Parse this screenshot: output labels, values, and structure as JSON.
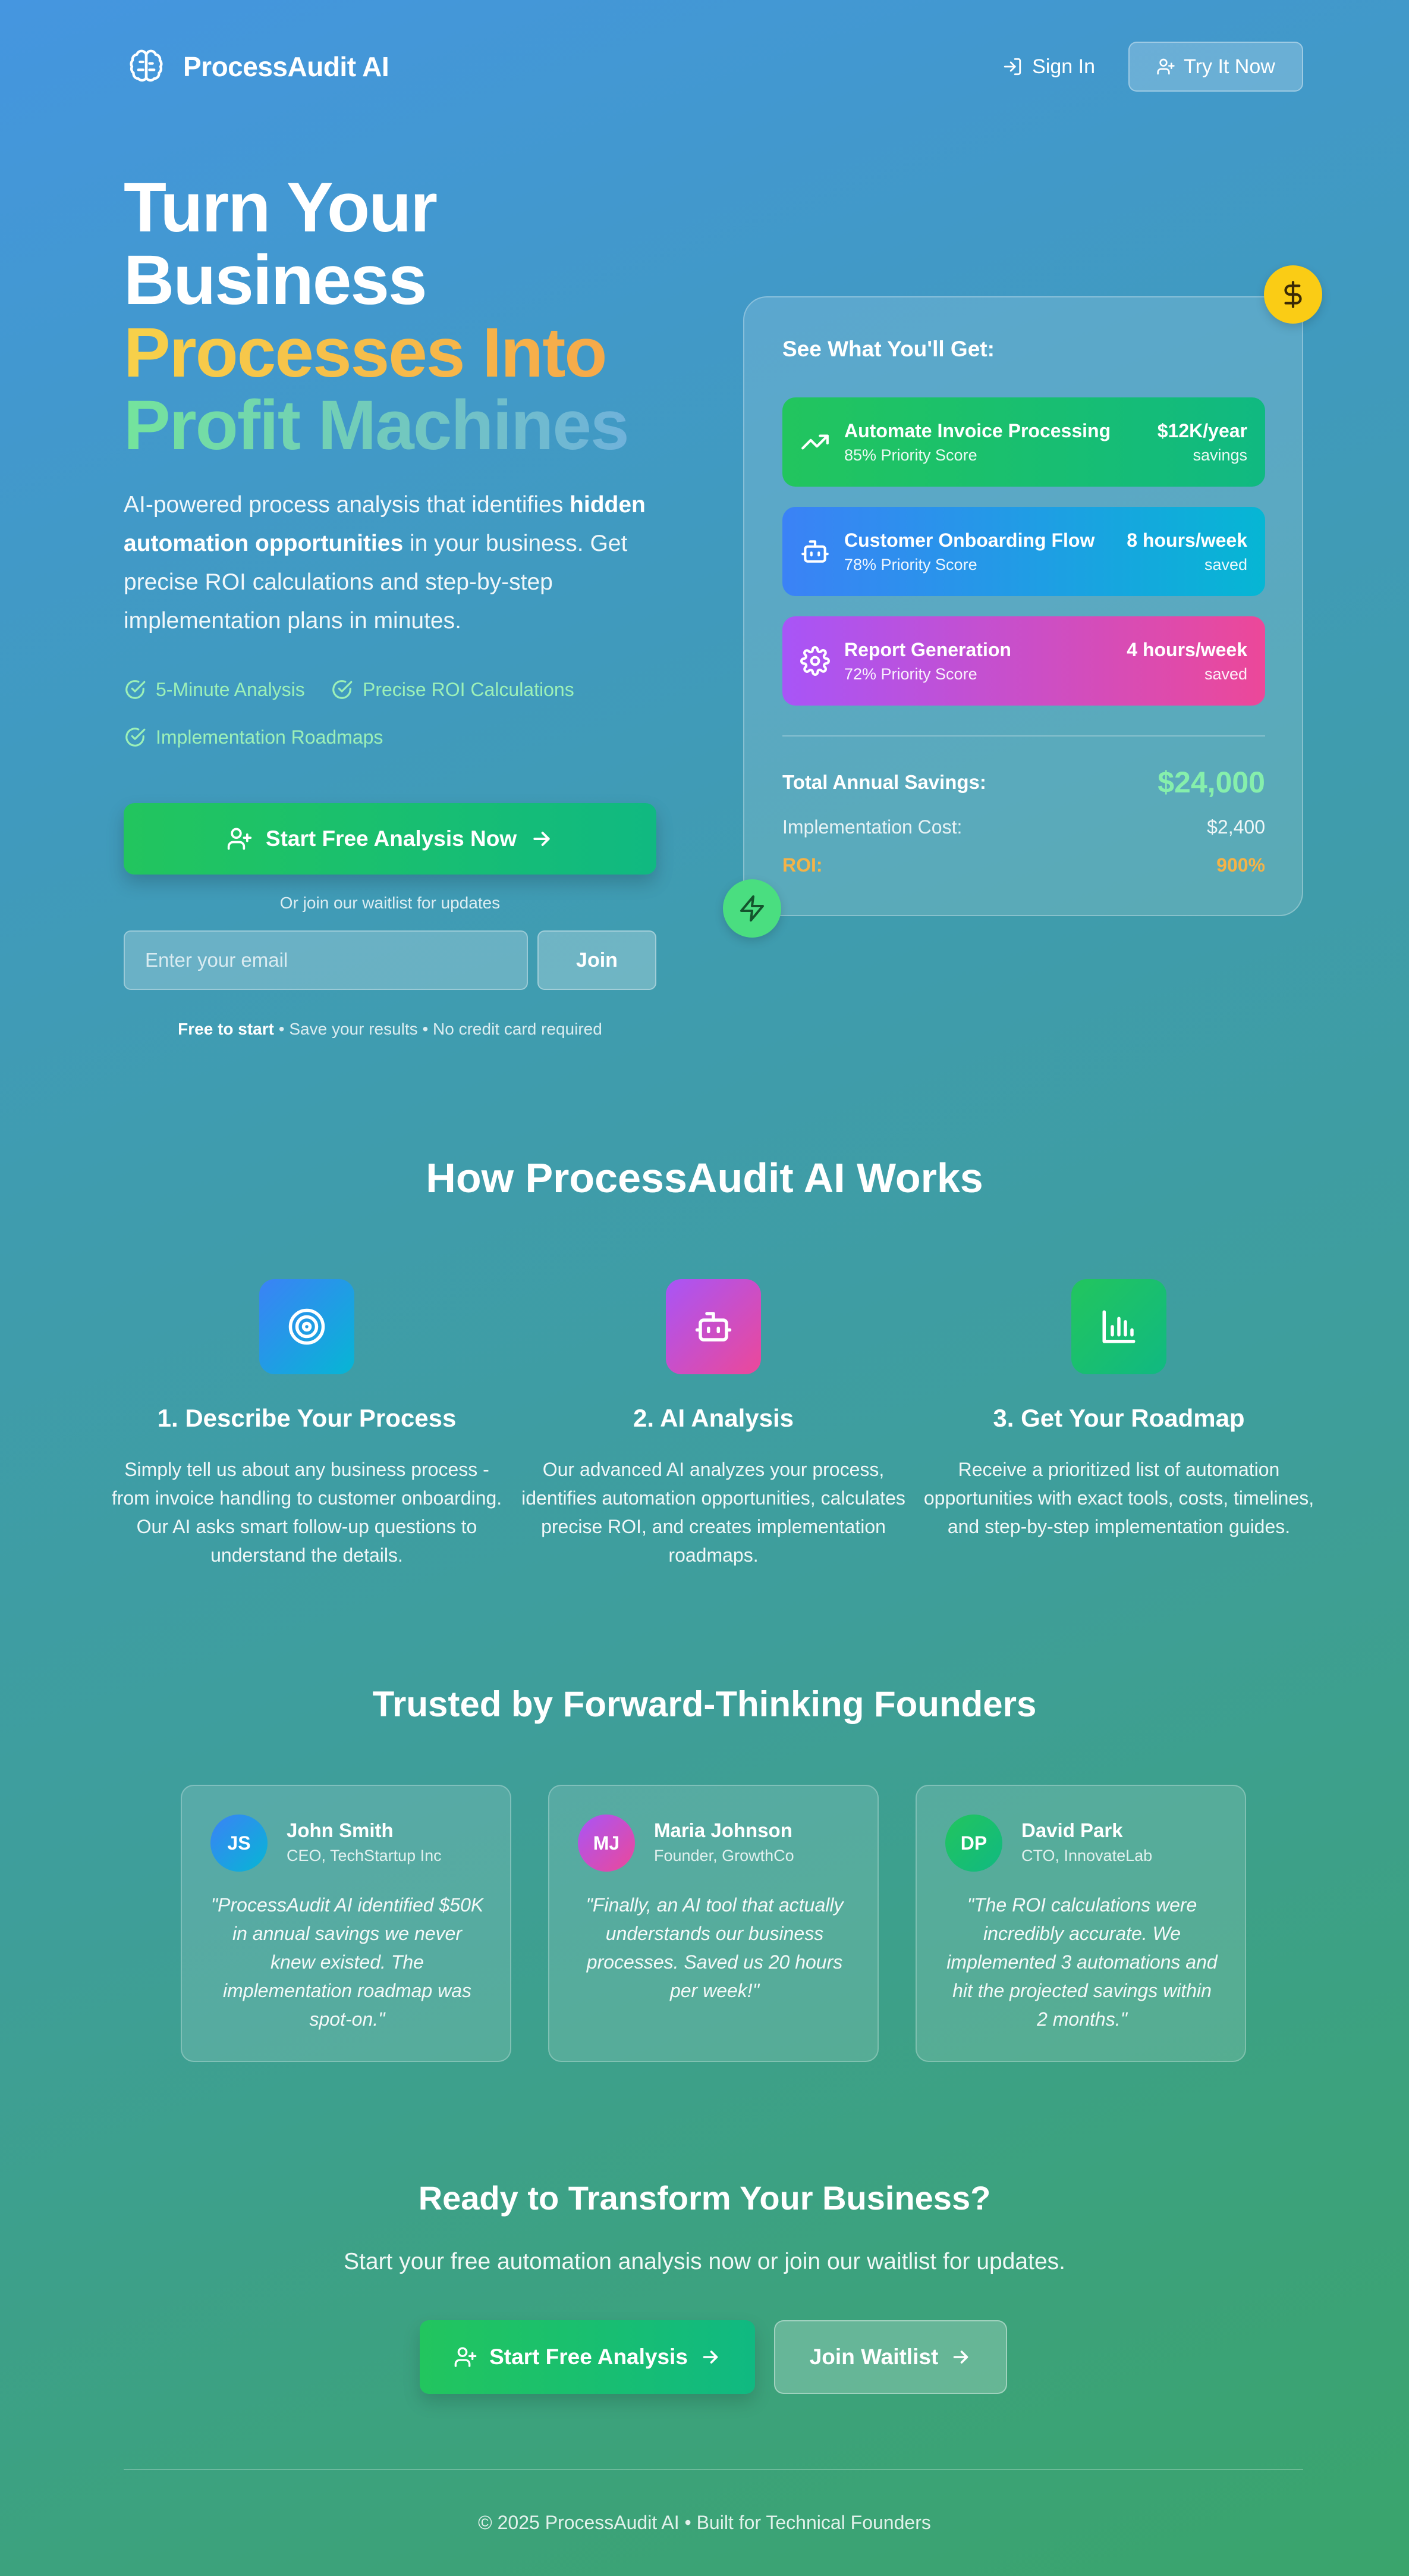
{
  "brand": {
    "name": "ProcessAudit AI"
  },
  "nav": {
    "signin_label": "Sign In",
    "tryit_label": "Try It Now"
  },
  "hero": {
    "title_line1": "Turn Your",
    "title_line2": "Business",
    "title_line3": "Processes Into",
    "title_line4": "Profit Machines",
    "desc_part1": "AI-powered process analysis that identifies ",
    "desc_bold": "hidden automation opportunities",
    "desc_part2": " in your business. Get precise ROI calculations and step-by-step implementation plans in minutes.",
    "features": [
      "5-Minute Analysis",
      "Precise ROI Calculations",
      "Implementation Roadmaps"
    ],
    "cta_label": "Start Free Analysis Now",
    "or_join": "Or join our waitlist for updates",
    "email_placeholder": "Enter your email",
    "join_label": "Join",
    "free_bold": "Free to start",
    "free_rest": " • Save your results • No credit card required"
  },
  "preview_card": {
    "title": "See What You'll Get:",
    "items": [
      {
        "name": "Automate Invoice Processing",
        "score": "85% Priority Score",
        "value": "$12K/year",
        "unit": "savings",
        "icon": "trending-up-icon",
        "color_from": "#22c55e",
        "color_to": "#10b981"
      },
      {
        "name": "Customer Onboarding Flow",
        "score": "78% Priority Score",
        "value": "8 hours/week",
        "unit": "saved",
        "icon": "bot-icon",
        "color_from": "#3b82f6",
        "color_to": "#06b6d4"
      },
      {
        "name": "Report Generation",
        "score": "72% Priority Score",
        "value": "4 hours/week",
        "unit": "saved",
        "icon": "gear-icon",
        "color_from": "#a855f7",
        "color_to": "#ec4899"
      }
    ],
    "total_label": "Total Annual Savings:",
    "total_value": "$24,000",
    "cost_label": "Implementation Cost:",
    "cost_value": "$2,400",
    "roi_label": "ROI:",
    "roi_value": "900%"
  },
  "how": {
    "title": "How ProcessAudit AI Works",
    "steps": [
      {
        "title": "1. Describe Your Process",
        "text": "Simply tell us about any business process - from invoice handling to customer onboarding. Our AI asks smart follow-up questions to understand the details.",
        "icon": "target-icon"
      },
      {
        "title": "2. AI Analysis",
        "text": "Our advanced AI analyzes your process, identifies automation opportunities, calculates precise ROI, and creates implementation roadmaps.",
        "icon": "bot-icon"
      },
      {
        "title": "3. Get Your Roadmap",
        "text": "Receive a prioritized list of automation opportunities with exact tools, costs, timelines, and step-by-step implementation guides.",
        "icon": "bar-chart-icon"
      }
    ]
  },
  "testimonials": {
    "title": "Trusted by Forward-Thinking Founders",
    "items": [
      {
        "initials": "JS",
        "name": "John Smith",
        "role": "CEO, TechStartup Inc",
        "quote": "\"ProcessAudit AI identified $50K in annual savings we never knew existed. The implementation roadmap was spot-on.\""
      },
      {
        "initials": "MJ",
        "name": "Maria Johnson",
        "role": "Founder, GrowthCo",
        "quote": "\"Finally, an AI tool that actually understands our business processes. Saved us 20 hours per week!\""
      },
      {
        "initials": "DP",
        "name": "David Park",
        "role": "CTO, InnovateLab",
        "quote": "\"The ROI calculations were incredibly accurate. We implemented 3 automations and hit the projected savings within 2 months.\""
      }
    ]
  },
  "final_cta": {
    "title": "Ready to Transform Your Business?",
    "subtitle": "Start your free automation analysis now or join our waitlist for updates.",
    "start_label": "Start Free Analysis",
    "waitlist_label": "Join Waitlist"
  },
  "footer": {
    "text": "© 2025 ProcessAudit AI • Built for Technical Founders"
  },
  "colors": {
    "accent_green": "#22c55e",
    "accent_yellow": "#facc15",
    "roi_orange": "#f5b347"
  }
}
